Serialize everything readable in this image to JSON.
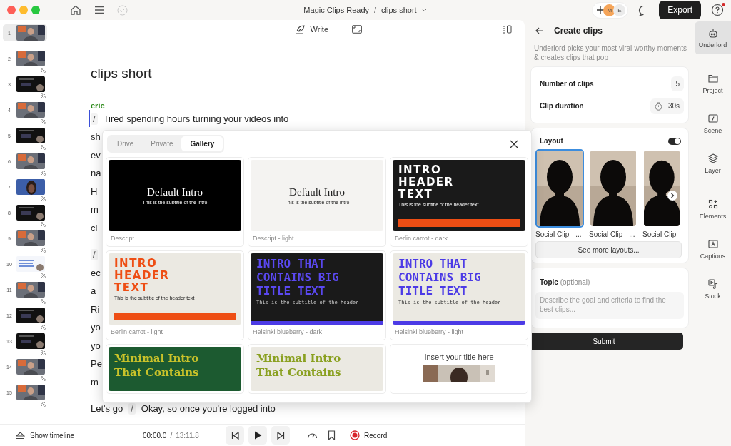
{
  "titlebar": {
    "breadcrumb": [
      "Magic Clips Ready",
      "clips short"
    ],
    "separator": "/",
    "avatars": [
      {
        "initial": "M",
        "color": "#f5a55a"
      },
      {
        "initial": "E",
        "color": "#ebebeb"
      }
    ],
    "export": "Export",
    "notification": true
  },
  "scenes": [
    {
      "number": "1",
      "selected": true,
      "transition": false,
      "kind": "webcam"
    },
    {
      "number": "2",
      "selected": false,
      "transition": true,
      "kind": "webcam"
    },
    {
      "number": "3",
      "selected": false,
      "transition": true,
      "kind": "screen"
    },
    {
      "number": "4",
      "selected": false,
      "transition": true,
      "kind": "webcam"
    },
    {
      "number": "5",
      "selected": false,
      "transition": true,
      "kind": "screen"
    },
    {
      "number": "6",
      "selected": false,
      "transition": true,
      "kind": "webcam"
    },
    {
      "number": "7",
      "selected": false,
      "transition": true,
      "kind": "portrait"
    },
    {
      "number": "8",
      "selected": false,
      "transition": true,
      "kind": "screen"
    },
    {
      "number": "9",
      "selected": false,
      "transition": true,
      "kind": "webcam"
    },
    {
      "number": "10",
      "selected": false,
      "transition": true,
      "kind": "document"
    },
    {
      "number": "11",
      "selected": false,
      "transition": true,
      "kind": "webcam"
    },
    {
      "number": "12",
      "selected": false,
      "transition": true,
      "kind": "screen"
    },
    {
      "number": "13",
      "selected": false,
      "transition": true,
      "kind": "screen"
    },
    {
      "number": "14",
      "selected": false,
      "transition": true,
      "kind": "webcam"
    },
    {
      "number": "15",
      "selected": false,
      "transition": true,
      "kind": "webcam"
    }
  ],
  "editor": {
    "write": "Write",
    "title": "clips short",
    "speaker": "eric",
    "lines": [
      {
        "focused": true,
        "marker": "/",
        "text": "Tired spending hours turning your videos into"
      },
      {
        "focused": false,
        "text": "sh"
      },
      {
        "focused": false,
        "text": "ev"
      },
      {
        "focused": false,
        "text": "na"
      },
      {
        "focused": false,
        "text": "H"
      },
      {
        "focused": false,
        "text": "m"
      },
      {
        "focused": false,
        "text": "cl"
      },
      {
        "focused": false,
        "marker": "/"
      },
      {
        "focused": false,
        "text": "ec"
      },
      {
        "focused": false,
        "text": "a"
      },
      {
        "focused": false,
        "text": "Ri"
      },
      {
        "focused": false,
        "text": "yo"
      },
      {
        "focused": false,
        "text": "yo"
      },
      {
        "focused": false,
        "text": "Pe"
      },
      {
        "focused": false,
        "text": "m"
      }
    ],
    "closing": {
      "before": "Let's go",
      "marker": "/",
      "after": "Okay, so once you're logged into"
    }
  },
  "gallery": {
    "tabs": [
      {
        "label": "Drive",
        "selected": false
      },
      {
        "label": "Private",
        "selected": false
      },
      {
        "label": "Gallery",
        "selected": true
      }
    ],
    "templates": [
      {
        "kind": "default-dark",
        "heading": "Default Intro",
        "subtitle": "This is the subtitle of the intro",
        "label": "Descript"
      },
      {
        "kind": "default-light",
        "heading": "Default Intro",
        "subtitle": "This is the subtitle of the intro",
        "label": "Descript - light"
      },
      {
        "kind": "berlin-dark",
        "heading": "INTRO HEADER TEXT",
        "subtitle": "This is the subtitle of the header text",
        "label": "Berlin carrot - dark"
      },
      {
        "kind": "berlin-light",
        "heading": "INTRO HEADER TEXT",
        "subtitle": "This is the subtitle of the header text",
        "label": "Berlin carrot - light"
      },
      {
        "kind": "helsinki-dark",
        "heading": "INTRO THAT CONTAINS BIG TITLE TEXT",
        "subtitle": "This is the subtitle of the header",
        "label": "Helsinki blueberry - dark"
      },
      {
        "kind": "helsinki-light",
        "heading": "INTRO THAT CONTAINS BIG TITLE TEXT",
        "subtitle": "This is the subtitle of the header",
        "label": "Helsinki blueberry - light"
      },
      {
        "kind": "minimal-dark",
        "heading": "Minimal Intro That Contains"
      },
      {
        "kind": "minimal-light",
        "heading": "Minimal Intro That Contains"
      },
      {
        "heading": "Insert your title here"
      }
    ]
  },
  "transport": {
    "timeline": "Show timeline",
    "current": "00:00.0",
    "separator": "/",
    "total": "13:11.8",
    "record": "Record"
  },
  "panel": {
    "title": "Create clips",
    "description": "Underlord picks your most viral-worthy moments & creates clips that pop",
    "settings": [
      {
        "label": "Number of clips",
        "value": "5",
        "kind": "count"
      },
      {
        "label": "Clip duration",
        "value": "30s",
        "kind": "duration"
      }
    ],
    "layout": {
      "label": "Layout",
      "on": true,
      "options": [
        {
          "label": "Social Clip - ...",
          "selected": true
        },
        {
          "label": "Social Clip - ...",
          "selected": false
        },
        {
          "label": "Social Clip -",
          "selected": false
        }
      ],
      "more": "See more layouts..."
    },
    "topic": {
      "label": "Topic",
      "hint": "(optional)",
      "placeholder": "Describe the goal and criteria to find the best clips..."
    },
    "submit": "Submit"
  },
  "rail": [
    {
      "label": "Underlord",
      "selected": true,
      "kind": "robot"
    },
    {
      "label": "Project",
      "selected": false,
      "kind": "folder"
    },
    {
      "label": "Scene",
      "selected": false,
      "kind": "scene"
    },
    {
      "label": "Layer",
      "selected": false,
      "kind": "layers"
    },
    {
      "label": "Elements",
      "selected": false,
      "kind": "elements"
    },
    {
      "label": "Captions",
      "selected": false,
      "kind": "captions"
    },
    {
      "label": "Stock",
      "selected": false,
      "kind": "stock"
    }
  ]
}
